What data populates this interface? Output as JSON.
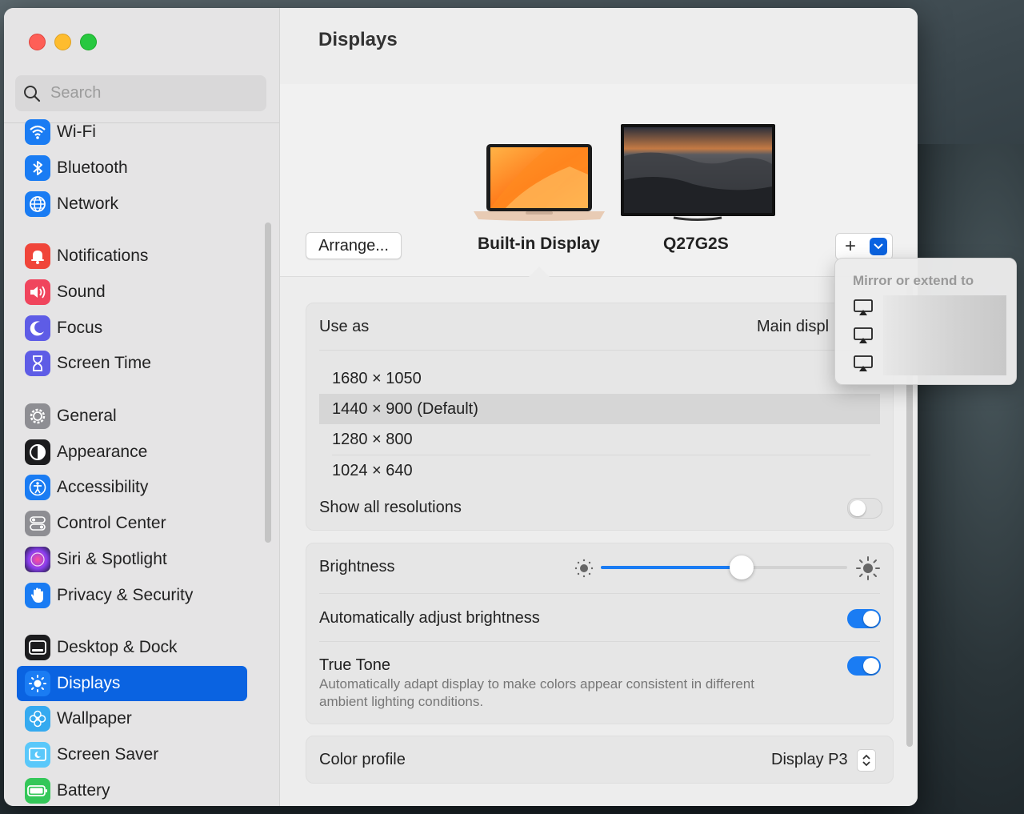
{
  "window": {
    "title": "Displays"
  },
  "sidebar": {
    "search_placeholder": "Search",
    "items": [
      {
        "label": "Wi-Fi",
        "icon": "wifi-icon",
        "color": "#1a7cf3"
      },
      {
        "label": "Bluetooth",
        "icon": "bluetooth-icon",
        "color": "#1a7cf3"
      },
      {
        "label": "Network",
        "icon": "globe-icon",
        "color": "#1a7cf3"
      },
      {
        "label": "Notifications",
        "icon": "bell-icon",
        "color": "#f0453a"
      },
      {
        "label": "Sound",
        "icon": "speaker-icon",
        "color": "#f0455d"
      },
      {
        "label": "Focus",
        "icon": "moon-icon",
        "color": "#5e5ce6"
      },
      {
        "label": "Screen Time",
        "icon": "hourglass-icon",
        "color": "#5e5ce6"
      },
      {
        "label": "General",
        "icon": "gear-icon",
        "color": "#8e8e93"
      },
      {
        "label": "Appearance",
        "icon": "appearance-icon",
        "color": "#1c1c1e"
      },
      {
        "label": "Accessibility",
        "icon": "accessibility-icon",
        "color": "#1a7cf3"
      },
      {
        "label": "Control Center",
        "icon": "control-center-icon",
        "color": "#8e8e93"
      },
      {
        "label": "Siri & Spotlight",
        "icon": "siri-icon",
        "color": "#b44fd9"
      },
      {
        "label": "Privacy & Security",
        "icon": "hand-icon",
        "color": "#1a7cf3"
      },
      {
        "label": "Desktop & Dock",
        "icon": "dock-icon",
        "color": "#1c1c1e"
      },
      {
        "label": "Displays",
        "icon": "sun-icon",
        "color": "#1a7cf3",
        "selected": true
      },
      {
        "label": "Wallpaper",
        "icon": "flower-icon",
        "color": "#35aaf0"
      },
      {
        "label": "Screen Saver",
        "icon": "screensaver-icon",
        "color": "#5ac8fa"
      },
      {
        "label": "Battery",
        "icon": "battery-icon",
        "color": "#34c759"
      }
    ]
  },
  "main": {
    "title": "Displays",
    "arrange_label": "Arrange...",
    "displays": [
      {
        "name": "Built-in Display",
        "selected": true
      },
      {
        "name": "Q27G2S",
        "selected": false
      }
    ],
    "add_label": "+",
    "use_as_label": "Use as",
    "use_as_value": "Main displ",
    "resolutions": [
      {
        "label": "1680 × 1050",
        "selected": false
      },
      {
        "label": "1440 × 900 (Default)",
        "selected": true
      },
      {
        "label": "1280 × 800",
        "selected": false
      },
      {
        "label": "1024 × 640",
        "selected": false
      }
    ],
    "show_all_label": "Show all resolutions",
    "show_all_on": false,
    "brightness_label": "Brightness",
    "brightness_level": 0.57,
    "auto_brightness_label": "Automatically adjust brightness",
    "auto_brightness_on": true,
    "true_tone_label": "True Tone",
    "true_tone_desc_line1": "Automatically adapt display to make colors appear consistent in different",
    "true_tone_desc_line2": "ambient lighting conditions.",
    "true_tone_on": true,
    "color_profile_label": "Color profile",
    "color_profile_value": "Display P3"
  },
  "menu": {
    "title": "Mirror or extend to",
    "items": [
      "airplay-icon",
      "airplay-icon",
      "airplay-icon"
    ]
  },
  "colors": {
    "accent": "#0a63e1",
    "toggle_on": "#1a7cf3"
  }
}
